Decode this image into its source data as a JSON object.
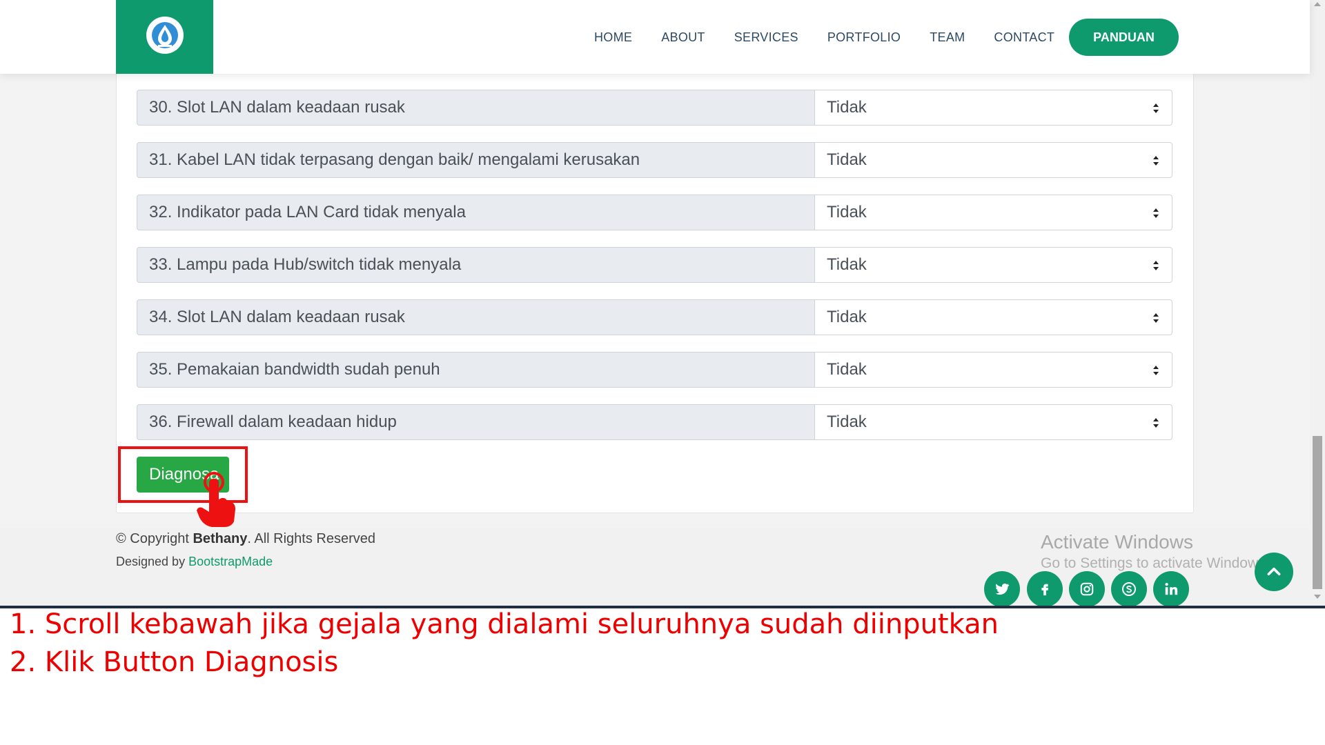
{
  "header": {
    "logo_label": "Bethany logo",
    "nav": [
      "HOME",
      "ABOUT",
      "SERVICES",
      "PORTFOLIO",
      "TEAM",
      "CONTACT"
    ],
    "cta_label": "PANDUAN"
  },
  "symptoms": [
    {
      "label": "30. Slot LAN dalam keadaan rusak",
      "value": "Tidak"
    },
    {
      "label": "31. Kabel LAN tidak terpasang dengan baik/ mengalami kerusakan",
      "value": "Tidak"
    },
    {
      "label": "32. Indikator pada LAN Card tidak menyala",
      "value": "Tidak"
    },
    {
      "label": "33. Lampu pada Hub/switch tidak menyala",
      "value": "Tidak"
    },
    {
      "label": "34. Slot LAN dalam keadaan rusak",
      "value": "Tidak"
    },
    {
      "label": "35. Pemakaian bandwidth sudah penuh",
      "value": "Tidak"
    },
    {
      "label": "36. Firewall dalam keadaan hidup",
      "value": "Tidak"
    }
  ],
  "diagnose_button": "Diagnosa",
  "footer": {
    "copyright_prefix": "© Copyright ",
    "copyright_brand": "Bethany",
    "copyright_suffix": ". All Rights Reserved",
    "designed_prefix": "Designed by ",
    "designed_link": "BootstrapMade"
  },
  "windows_watermark": {
    "title": "Activate Windows",
    "subtitle": "Go to Settings to activate Windows."
  },
  "social_icons": [
    "twitter-icon",
    "facebook-icon",
    "instagram-icon",
    "skype-icon",
    "linkedin-icon"
  ],
  "colors": {
    "primary": "#0e9a6c",
    "diagnose_button": "#28a745",
    "annotation": "#ee0000"
  },
  "instructions": [
    "1. Scroll kebawah jika gejala yang dialami seluruhnya sudah diinputkan",
    "2. Klik Button Diagnosis"
  ]
}
